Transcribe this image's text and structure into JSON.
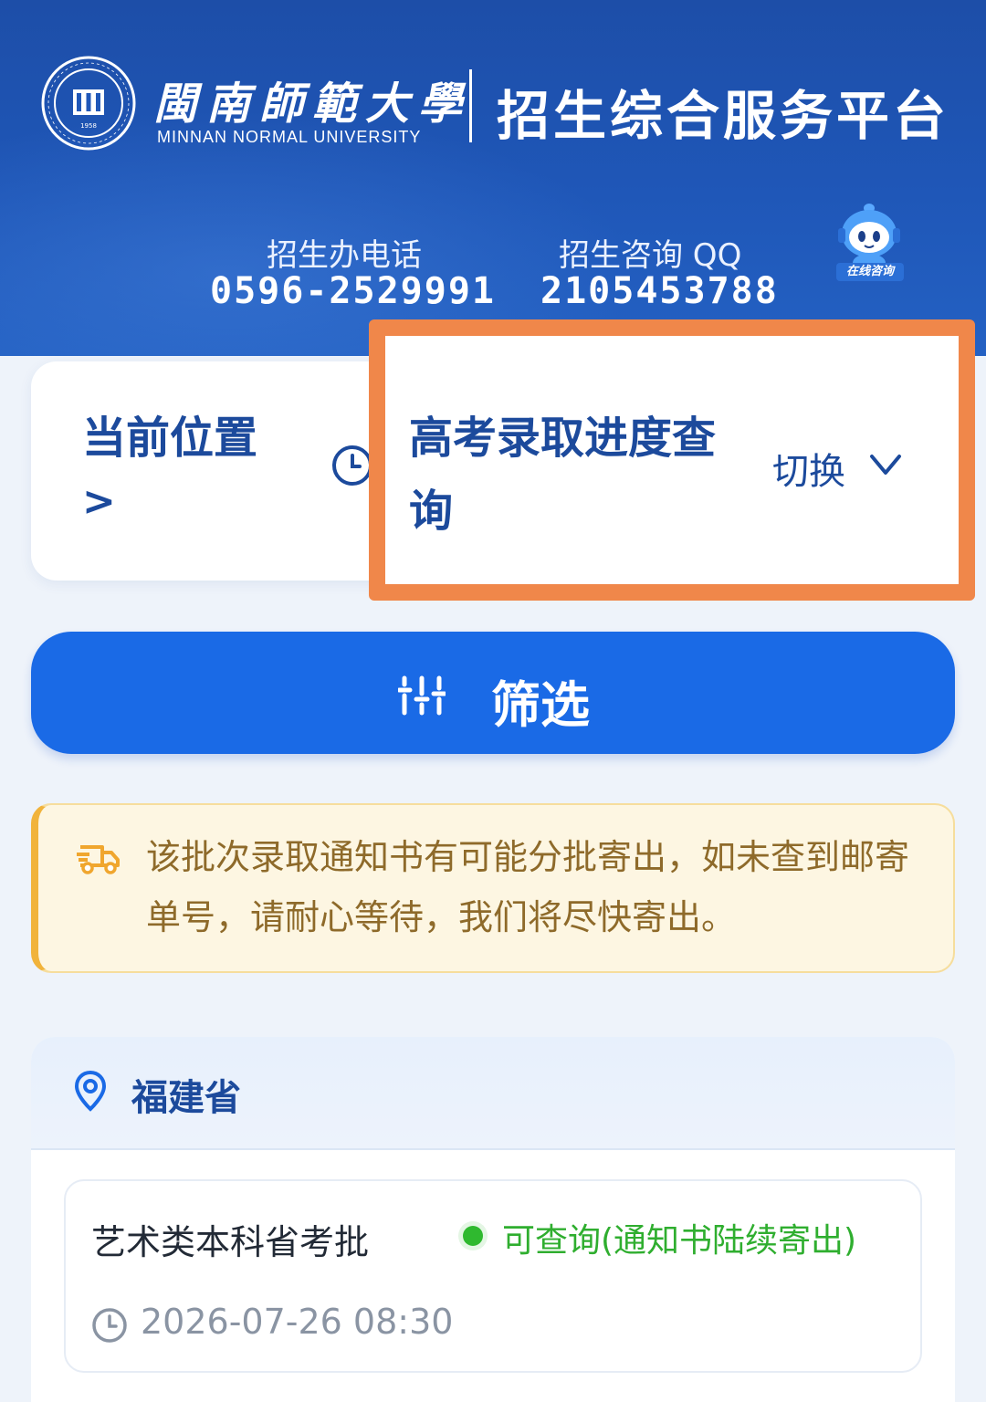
{
  "header": {
    "university_name_cn": "閩南師範大學",
    "university_name_en": "MINNAN  NORMAL  UNIVERSITY",
    "seal_text": "1958",
    "platform_title": "招生综合服务平台",
    "phone_label": "招生办电话",
    "phone_value": "0596-2529991",
    "qq_label": "招生咨询 QQ",
    "qq_value": "2105453788",
    "online_consult_label": "在线咨询"
  },
  "location": {
    "title": "当前位置",
    "arrow": ">",
    "current_page": "高考录取进度查询",
    "switch_label": "切换"
  },
  "filter": {
    "label": "筛选"
  },
  "notice": {
    "text": "该批次录取通知书有可能分批寄出，如未查到邮寄单号，请耐心等待，我们将尽快寄出。"
  },
  "province": {
    "name": "福建省",
    "batches": [
      {
        "name": "艺术类本科省考批",
        "status": "可查询(通知书陆续寄出)",
        "time": "2026-07-26 08:30"
      }
    ]
  },
  "colors": {
    "header_blue": "#1f57b8",
    "primary_blue": "#1a6ae6",
    "title_blue": "#1c4a9c",
    "highlight_orange": "#f0874a",
    "notice_bg": "#fdf6e2",
    "status_green": "#2fb92f"
  },
  "icons": {
    "seal": "university-seal-icon",
    "robot": "robot-assistant-icon",
    "clock": "clock-icon",
    "chevron": "chevron-down-icon",
    "filter": "sliders-icon",
    "truck": "truck-icon",
    "pin": "location-pin-icon"
  }
}
